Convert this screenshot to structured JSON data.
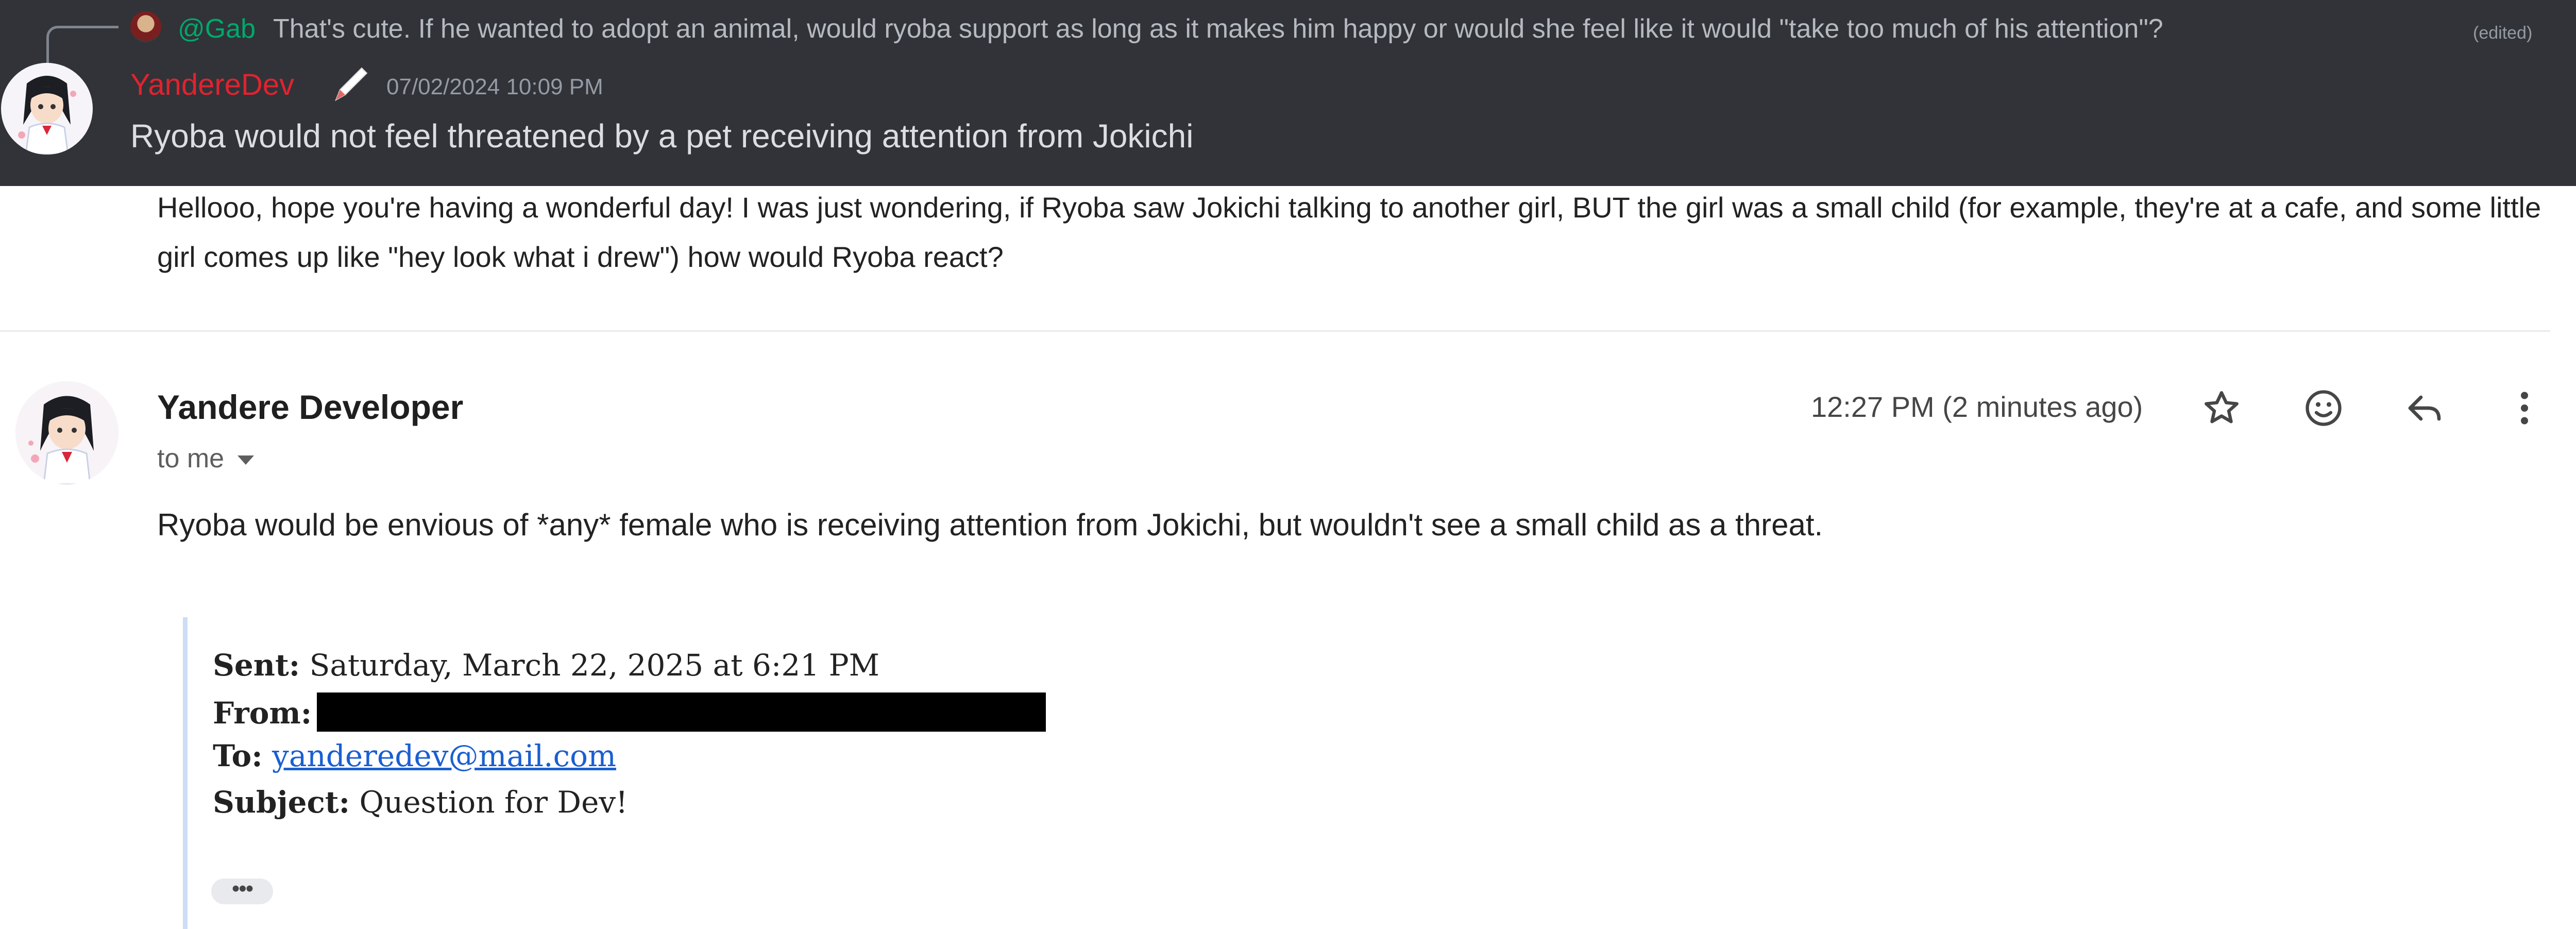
{
  "discord": {
    "reply": {
      "mention": "@Gab",
      "text": "That's cute. If he wanted to adopt an animal, would ryoba support as long as it makes him happy or would she feel like it would \"take too much of his attention\"?",
      "edited": "(edited)"
    },
    "message": {
      "username": "YandereDev",
      "timestamp": "07/02/2024 10:09 PM",
      "content": "Ryoba would not feel threatened by a pet receiving attention from Jokichi"
    },
    "colors": {
      "username": "#e0232f",
      "mention": "#00a86b",
      "background": "#313338"
    }
  },
  "email": {
    "question": "Hellooo, hope you're having a wonderful day! I was just wondering, if Ryoba saw Jokichi talking to another girl, BUT the girl was a small child (for example, they're at a cafe, and some little girl comes up like \"hey look what i drew\") how would Ryoba react?",
    "sender": "Yandere Developer",
    "recipient": "to me",
    "time": "12:27 PM (2 minutes ago)",
    "actions": [
      "star-icon",
      "emoji-icon",
      "reply-icon",
      "more-vert-icon"
    ],
    "body": "Ryoba would be envious of *any* female who is receiving attention from Jokichi, but wouldn't see a small child as a threat.",
    "quoted": {
      "sent_label": "Sent:",
      "sent_value": "Saturday, March 22, 2025 at 6:21 PM",
      "from_label": "From:",
      "to_label": "To:",
      "to_value": "yanderedev@mail.com",
      "subject_label": "Subject:",
      "subject_value": "Question for Dev!"
    },
    "expand_label": "•••"
  }
}
